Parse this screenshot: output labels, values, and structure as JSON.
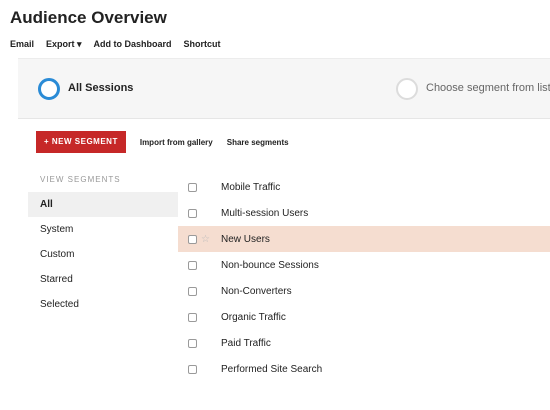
{
  "page": {
    "title": "Audience Overview"
  },
  "actions": [
    "Email",
    "Export ▾",
    "Add to Dashboard",
    "Shortcut"
  ],
  "segments": {
    "active_label": "All Sessions",
    "placeholder_label": "Choose segment from list",
    "active_color": "#2a8bd6"
  },
  "toolbar": {
    "new_segment": "+ NEW SEGMENT",
    "import": "Import from gallery",
    "share": "Share segments",
    "new_segment_color": "#c62828"
  },
  "sidebar": {
    "header": "VIEW SEGMENTS",
    "items": [
      "All",
      "System",
      "Custom",
      "Starred",
      "Selected"
    ]
  },
  "segment_list": [
    {
      "label": "Mobile Traffic"
    },
    {
      "label": "Multi-session Users"
    },
    {
      "label": "New Users"
    },
    {
      "label": "Non-bounce Sessions"
    },
    {
      "label": "Non-Converters"
    },
    {
      "label": "Organic Traffic"
    },
    {
      "label": "Paid Traffic"
    },
    {
      "label": "Performed Site Search"
    }
  ],
  "highlight_color": "#f5ddd0"
}
